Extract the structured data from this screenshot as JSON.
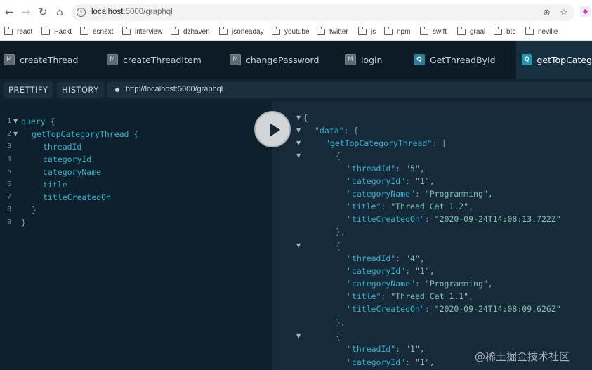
{
  "browser": {
    "url_host": "localhost",
    "url_path": ":5000/graphql",
    "bookmarks": [
      "react",
      "Packt",
      "esnext",
      "interview",
      "dzhaven",
      "jsoneaday",
      "youtube",
      "twitter",
      "js",
      "npm",
      "swift",
      "graal",
      "btc",
      "neville"
    ]
  },
  "tabs": [
    {
      "badge": "M",
      "label": "createThread"
    },
    {
      "badge": "M",
      "label": "createThreadItem"
    },
    {
      "badge": "M",
      "label": "changePassword"
    },
    {
      "badge": "M",
      "label": "login"
    },
    {
      "badge": "Q",
      "label": "GetThreadById"
    },
    {
      "badge": "Q",
      "label": "getTopCateg"
    }
  ],
  "toolbar": {
    "prettify_label": "PRETTIFY",
    "history_label": "HISTORY",
    "endpoint": "http://localhost:5000/graphql"
  },
  "editor": {
    "line_numbers": [
      "1",
      "2",
      "3",
      "4",
      "5",
      "6",
      "7",
      "8",
      "9"
    ],
    "lines": [
      "query {",
      "getTopCategoryThread {",
      "threadId",
      "categoryId",
      "categoryName",
      "title",
      "titleCreatedOn",
      "}",
      "}"
    ]
  },
  "result": {
    "key_data": "\"data\"",
    "key_list": "\"getTopCategoryThread\"",
    "field_keys": [
      "\"threadId\"",
      "\"categoryId\"",
      "\"categoryName\"",
      "\"title\"",
      "\"titleCreatedOn\""
    ],
    "items": [
      {
        "threadId": "\"5\",",
        "categoryId": "\"1\",",
        "categoryName": "\"Programming\",",
        "title": "\"Thread Cat 1.2\",",
        "titleCreatedOn": "\"2020-09-24T14:08:13.722Z\""
      },
      {
        "threadId": "\"4\",",
        "categoryId": "\"1\",",
        "categoryName": "\"Programming\",",
        "title": "\"Thread Cat 1.1\",",
        "titleCreatedOn": "\"2020-09-24T14:08:09.626Z\""
      },
      {
        "threadId": "\"1\",",
        "categoryId": "\"1\","
      }
    ]
  },
  "watermark": "@稀土掘金技术社区"
}
